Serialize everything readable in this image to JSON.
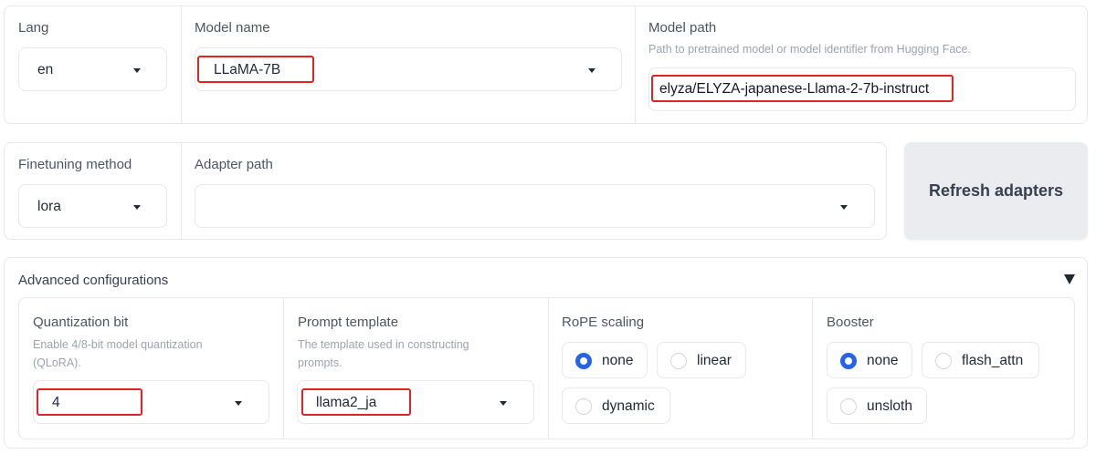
{
  "top_row": {
    "lang": {
      "label": "Lang",
      "value": "en"
    },
    "model_name": {
      "label": "Model name",
      "value": "LLaMA-7B"
    },
    "model_path": {
      "label": "Model path",
      "info": "Path to pretrained model or model identifier from Hugging Face.",
      "value": "elyza/ELYZA-japanese-Llama-2-7b-instruct"
    }
  },
  "middle_row": {
    "finetuning_method": {
      "label": "Finetuning method",
      "value": "lora"
    },
    "adapter_path": {
      "label": "Adapter path",
      "value": ""
    },
    "refresh_button": "Refresh adapters"
  },
  "advanced": {
    "title": "Advanced configurations",
    "quantization": {
      "label": "Quantization bit",
      "info_line1": "Enable 4/8-bit model quantization",
      "info_line2": "(QLoRA).",
      "value": "4"
    },
    "prompt_template": {
      "label": "Prompt template",
      "info_line1": "The template used in constructing",
      "info_line2": "prompts.",
      "value": "llama2_ja"
    },
    "rope_scaling": {
      "label": "RoPE scaling",
      "options": [
        "none",
        "linear",
        "dynamic"
      ],
      "selected": "none"
    },
    "booster": {
      "label": "Booster",
      "options": [
        "none",
        "flash_attn",
        "unsloth"
      ],
      "selected": "none"
    }
  },
  "colors": {
    "accent": "#2563eb",
    "highlight": "#e02424",
    "button_bg": "#ebecef",
    "border": "#e5e7eb"
  }
}
